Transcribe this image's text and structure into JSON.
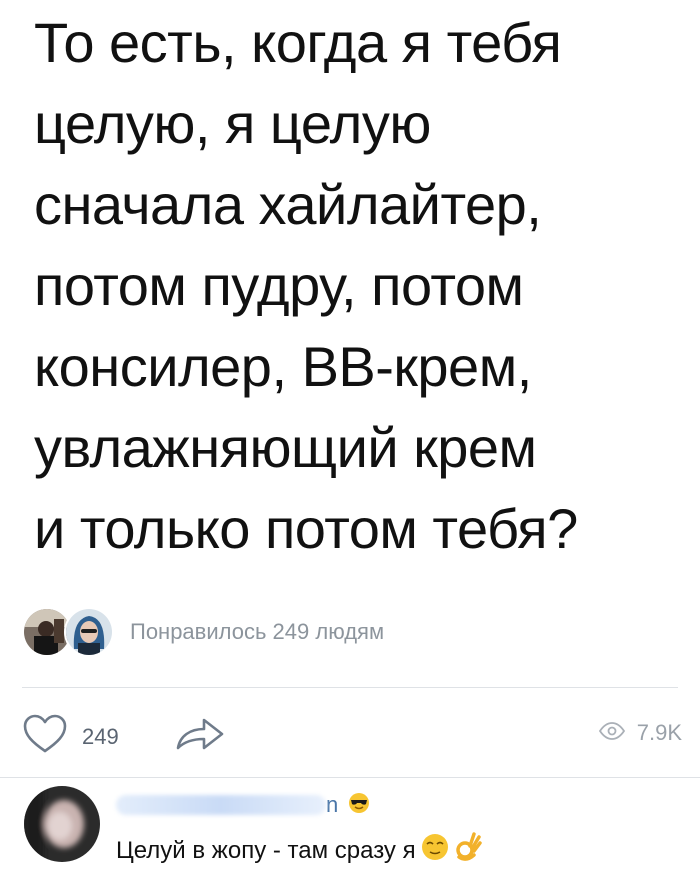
{
  "post": {
    "lines": [
      "То есть, когда я тебя",
      "целую, я целую",
      "сначала хайлайтер,",
      "потом пудру, потом",
      "консилер, ВВ-крем,",
      "увлажняющий крем",
      "и только потом тебя?"
    ]
  },
  "likes": {
    "summary": "Понравилось 249 людям"
  },
  "actions": {
    "like_count": "249",
    "views_count": "7.9K",
    "like_icon": "heart-icon",
    "share_icon": "share-arrow-icon",
    "views_icon": "eye-icon"
  },
  "comment": {
    "author_visible_tail": "n",
    "text": "Целуй в жопу - там сразу я",
    "emoji_after_name": "sunglasses-face-icon",
    "emoji_after_text": [
      "relieved-face-icon",
      "ok-hand-icon"
    ]
  },
  "colors": {
    "text": "#111111",
    "muted": "#8c949c",
    "link": "#4a76a8",
    "divider": "#dfe2e6"
  }
}
